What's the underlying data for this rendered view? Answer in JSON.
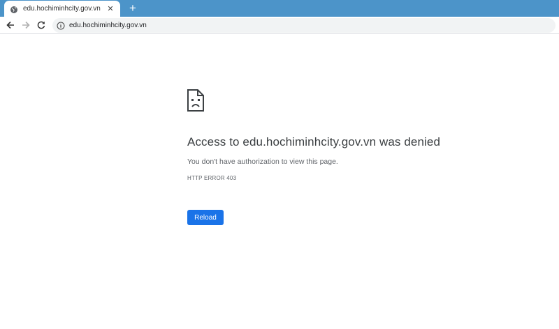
{
  "tab": {
    "title": "edu.hochiminhcity.gov.vn",
    "close": "✕",
    "new_tab": "+"
  },
  "address_bar": {
    "url": "edu.hochiminhcity.gov.vn"
  },
  "error_page": {
    "headline": "Access to edu.hochiminhcity.gov.vn was denied",
    "description": "You don't have authorization to view this page.",
    "error_code": "HTTP ERROR 403",
    "reload_label": "Reload"
  },
  "colors": {
    "tab_strip": "#4c94c9",
    "button": "#1a73e8"
  }
}
